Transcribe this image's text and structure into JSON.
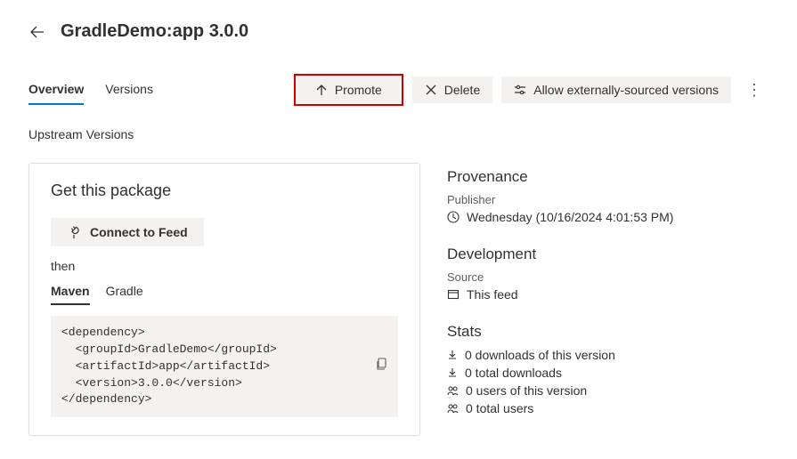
{
  "header": {
    "title": "GradleDemo:app 3.0.0"
  },
  "tabs": {
    "overview": "Overview",
    "versions": "Versions"
  },
  "actions": {
    "promote": "Promote",
    "delete": "Delete",
    "allow_external": "Allow externally-sourced versions"
  },
  "upstream_heading": "Upstream Versions",
  "get_package": {
    "title": "Get this package",
    "connect_label": "Connect to Feed",
    "then": "then",
    "tabs": {
      "maven": "Maven",
      "gradle": "Gradle"
    },
    "code": "<dependency>\n  <groupId>GradleDemo</groupId>\n  <artifactId>app</artifactId>\n  <version>3.0.0</version>\n</dependency>"
  },
  "provenance": {
    "title": "Provenance",
    "publisher_label": "Publisher",
    "date": "Wednesday (10/16/2024 4:01:53 PM)"
  },
  "development": {
    "title": "Development",
    "source_label": "Source",
    "source_value": "This feed"
  },
  "stats": {
    "title": "Stats",
    "items": [
      "0 downloads of this version",
      "0 total downloads",
      "0 users of this version",
      "0 total users"
    ]
  }
}
